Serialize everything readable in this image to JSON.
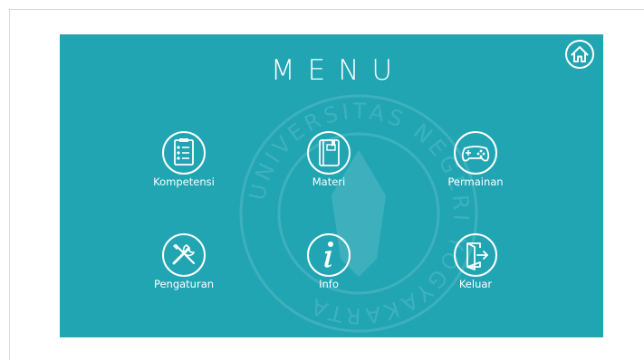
{
  "title": "MENU",
  "watermark": {
    "text": "UNIVERSITAS NEGERI YOGYAKARTA"
  },
  "menu": {
    "items": [
      {
        "label": "Kompetensi",
        "icon": "checklist-icon"
      },
      {
        "label": "Materi",
        "icon": "book-icon"
      },
      {
        "label": "Permainan",
        "icon": "gamepad-icon"
      },
      {
        "label": "Pengaturan",
        "icon": "tools-icon"
      },
      {
        "label": "Info",
        "icon": "info-icon"
      },
      {
        "label": "Keluar",
        "icon": "exit-door-icon"
      }
    ]
  },
  "home_button": {
    "icon": "home-icon"
  },
  "colors": {
    "background": "#21a5b3",
    "foreground": "#ffffff"
  }
}
